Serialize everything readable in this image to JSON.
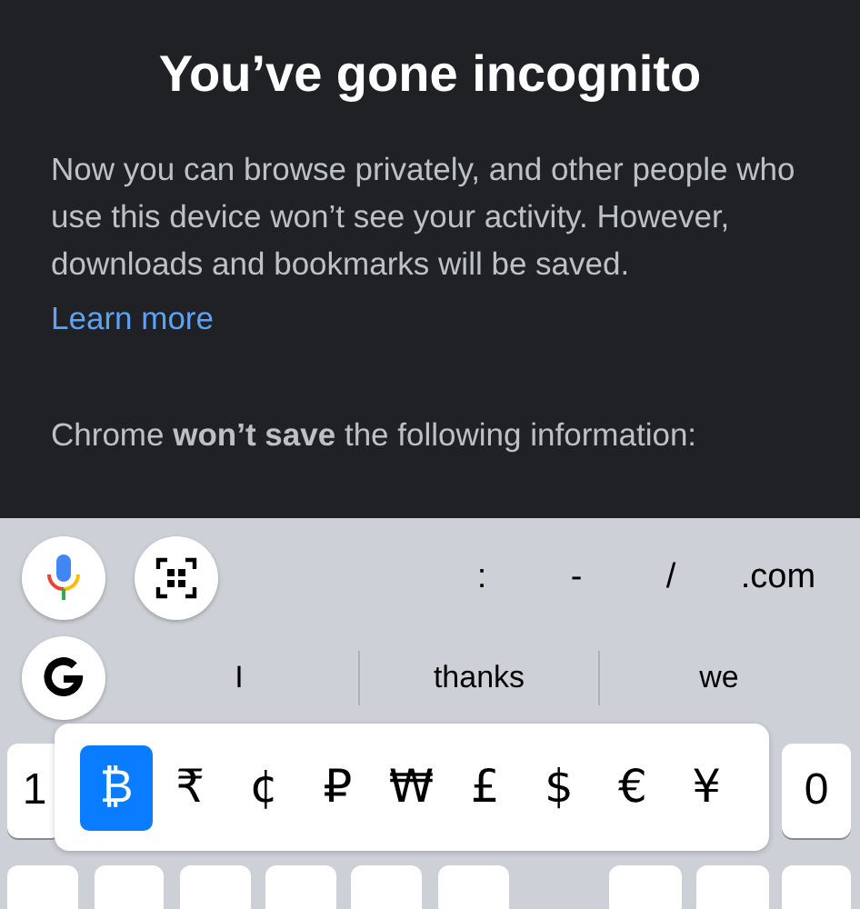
{
  "incognito": {
    "title": "You’ve gone incognito",
    "body": "Now you can browse privately, and other people who use this device won’t see your activity. However, downloads and bookmarks will be saved.",
    "link": "Learn more",
    "notice": "Chrome **won’t save** the following information:"
  },
  "toolbar": {
    "shortcuts": [
      ":",
      "-",
      "/",
      ".com"
    ]
  },
  "suggestions": [
    "I",
    "thanks",
    "we"
  ],
  "number_row": {
    "left_key": "1",
    "right_key": "0"
  },
  "currency_popup": [
    {
      "symbol": "₿",
      "selected": true
    },
    {
      "symbol": "₹",
      "selected": false
    },
    {
      "symbol": "¢",
      "selected": false
    },
    {
      "symbol": "₽",
      "selected": false
    },
    {
      "symbol": "₩",
      "selected": false
    },
    {
      "symbol": "£",
      "selected": false
    },
    {
      "symbol": "$",
      "selected": false
    },
    {
      "symbol": "€",
      "selected": false
    },
    {
      "symbol": "¥",
      "selected": false
    }
  ]
}
